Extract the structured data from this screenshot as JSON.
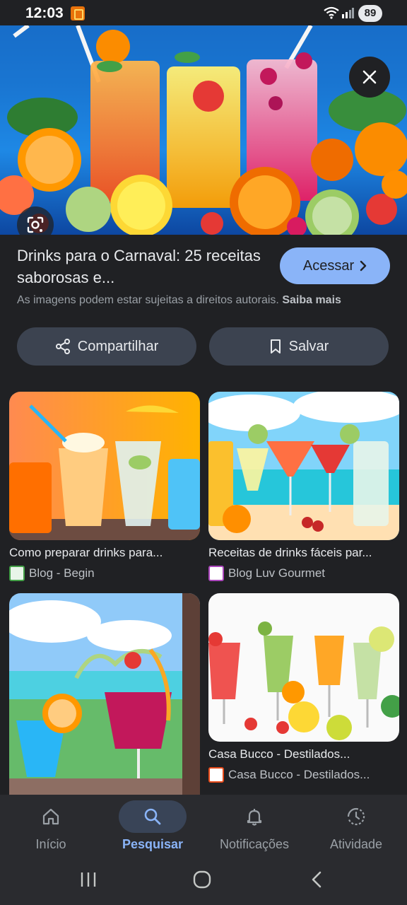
{
  "status_bar": {
    "time": "12:03",
    "battery": "89"
  },
  "hero": {
    "alt": "Drinks coloridos com frutas"
  },
  "result": {
    "title": "Drinks para o Carnaval: 25 receitas saborosas e...",
    "visit_label": "Acessar",
    "copyright_text": "As imagens podem estar sujeitas a direitos autorais.",
    "learn_more": "Saiba mais",
    "share_label": "Compartilhar",
    "save_label": "Salvar"
  },
  "related": [
    {
      "title": "Como preparar drinks para...",
      "source": "Blog - Begin"
    },
    {
      "title": "Receitas de drinks fáceis par...",
      "source": "Blog Luv Gourmet"
    },
    {
      "title": "",
      "source": ""
    },
    {
      "title": "Casa Bucco - Destilados...",
      "source": "Casa Bucco - Destilados..."
    }
  ],
  "bottom_nav": [
    {
      "label": "Início",
      "icon": "home-icon",
      "active": false
    },
    {
      "label": "Pesquisar",
      "icon": "search-icon",
      "active": true
    },
    {
      "label": "Notificações",
      "icon": "bell-icon",
      "active": false
    },
    {
      "label": "Atividade",
      "icon": "history-icon",
      "active": false
    }
  ],
  "colors": {
    "accent": "#8ab4f8",
    "background": "#202124",
    "chip": "#3c4350"
  }
}
